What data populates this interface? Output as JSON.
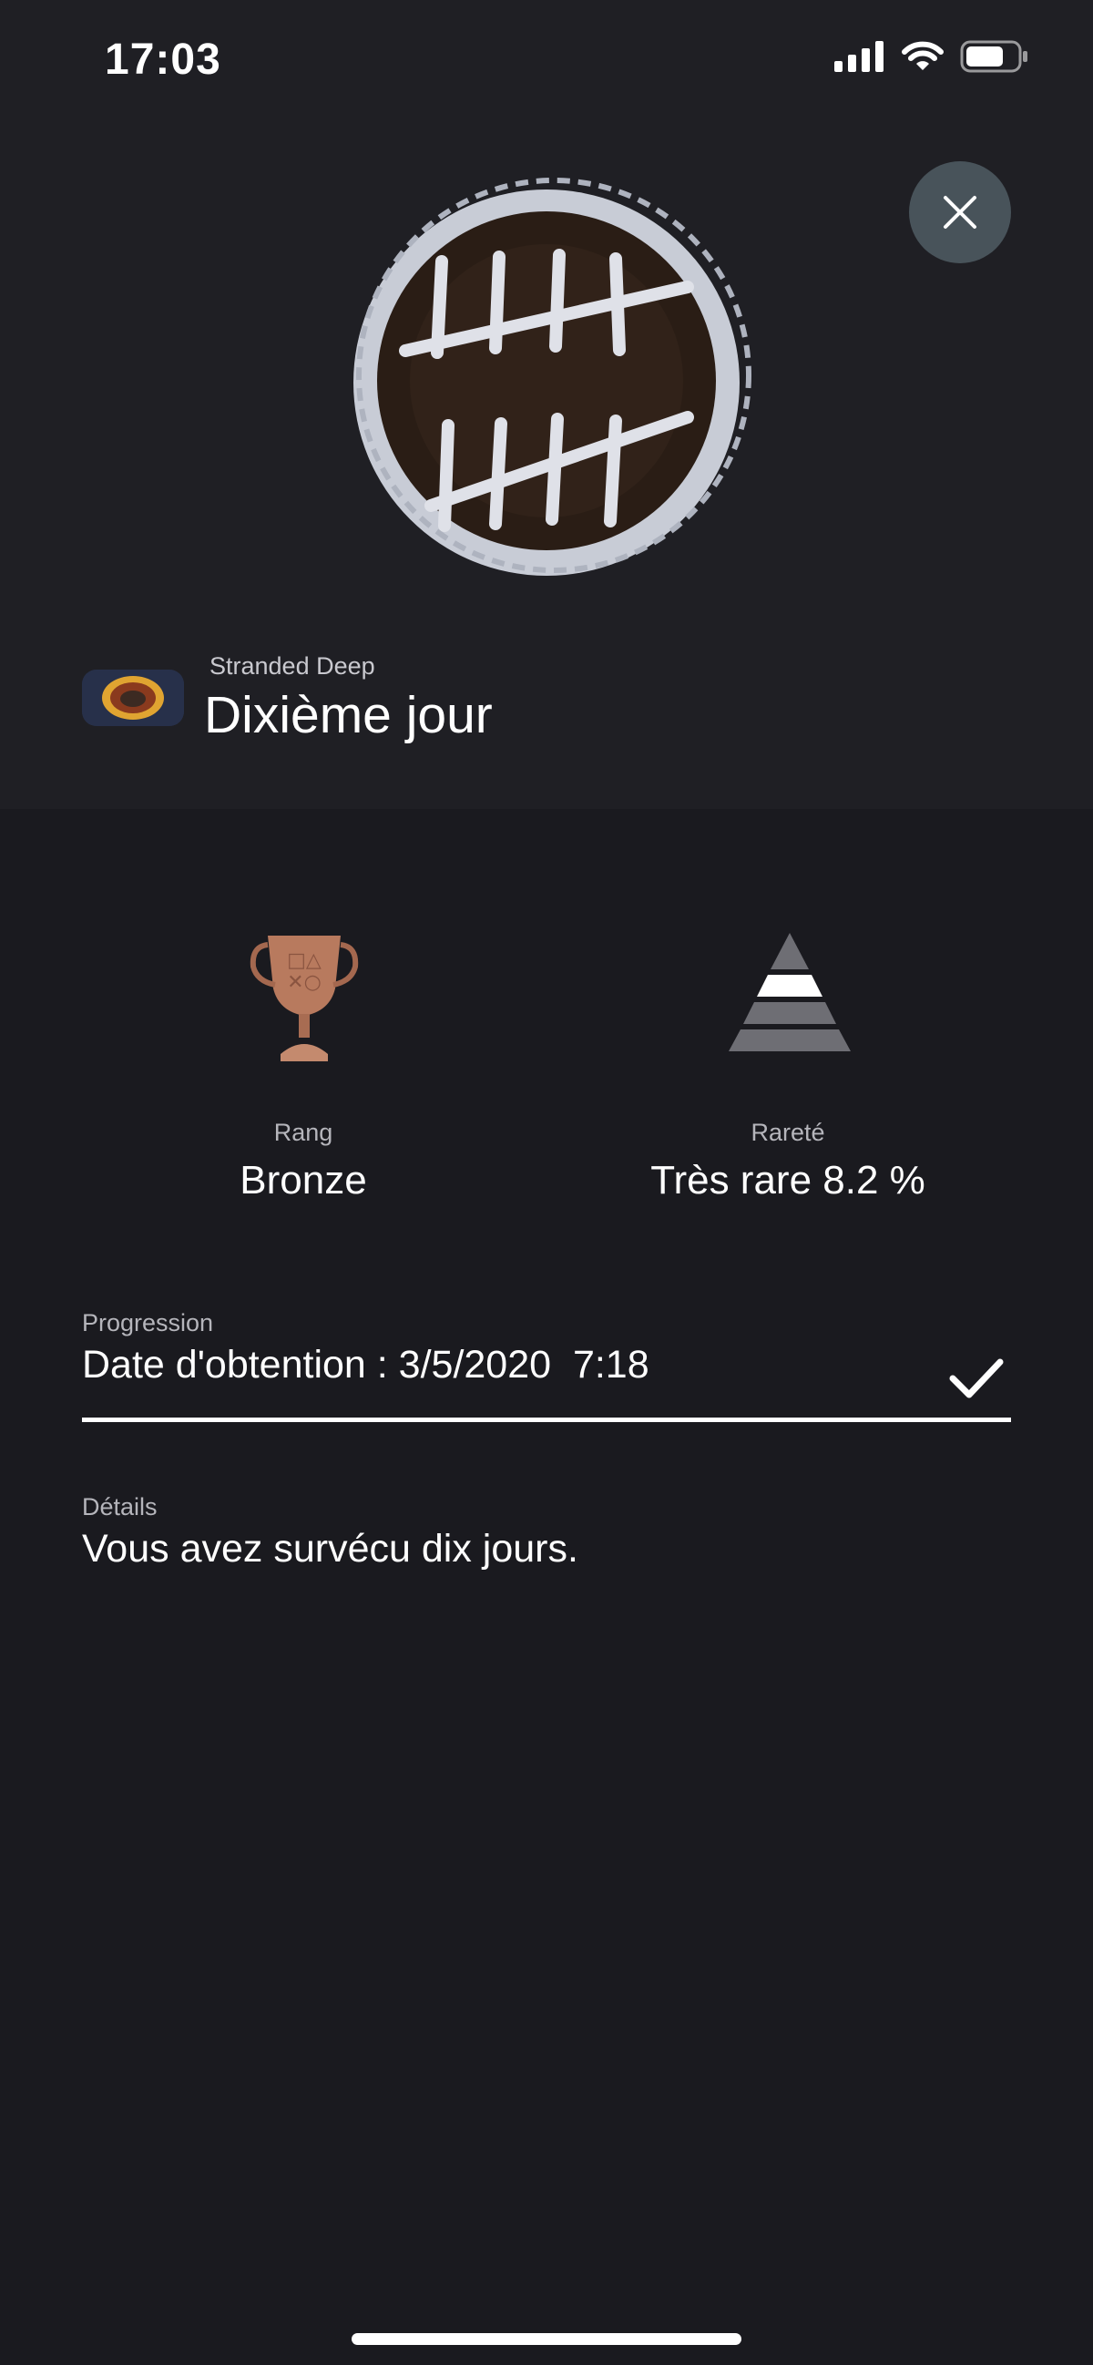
{
  "status_bar": {
    "time": "17:03"
  },
  "header": {
    "game_name": "Stranded Deep",
    "trophy_name": "Dixième jour"
  },
  "stats": {
    "rank": {
      "label": "Rang",
      "value": "Bronze"
    },
    "rarity": {
      "label": "Rareté",
      "value": "Très rare 8.2 %"
    }
  },
  "progression": {
    "label": "Progression",
    "value": "Date d'obtention : 3/5/2020  7:18",
    "progress_percent": 100
  },
  "details": {
    "label": "Détails",
    "value": "Vous avez survécu dix jours."
  },
  "icons": {
    "close": "close-icon",
    "trophy": "bronze-trophy-icon",
    "rarity": "rarity-pyramid-icon",
    "check": "check-icon"
  },
  "colors": {
    "background": "#1a1a1f",
    "header_background": "#1f1f24",
    "bronze": "#b87a5e",
    "close_button": "#48535a"
  }
}
